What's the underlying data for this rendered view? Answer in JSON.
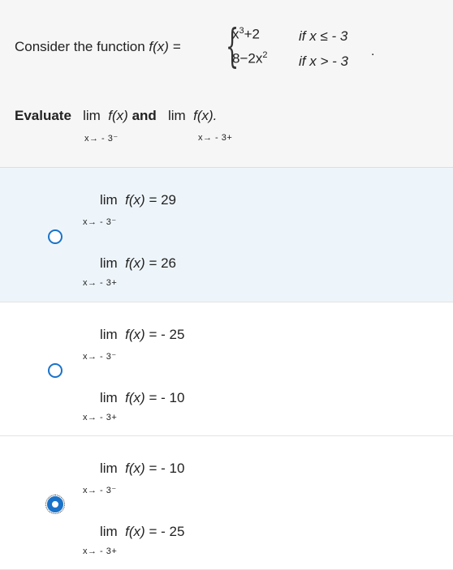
{
  "question": {
    "intro": "Consider the function",
    "fx": "f(x) =",
    "piece1_expr": "x",
    "piece1_exp": "3",
    "piece1_rest": "+2",
    "piece1_cond": "if x ≤ - 3",
    "piece2_expr": "8−2x",
    "piece2_exp": "2",
    "piece2_cond": "if x > - 3",
    "period": ".",
    "evaluate_word": "Evaluate",
    "lim1": "lim",
    "lim1_fx": "f(x)",
    "lim1_sub": "x→ - 3⁻",
    "and_word": "and",
    "lim2": "lim",
    "lim2_fx": "f(x).",
    "lim2_sub": "x→ - 3+"
  },
  "options": [
    {
      "selected": false,
      "line1": {
        "lim": "lim",
        "fx": "f(x)",
        "value": "= 29",
        "sub": "x→ - 3⁻"
      },
      "line2": {
        "lim": "lim",
        "fx": "f(x)",
        "value": "= 26",
        "sub": "x→ - 3+"
      }
    },
    {
      "selected": false,
      "line1": {
        "lim": "lim",
        "fx": "f(x)",
        "value": "= - 25",
        "sub": "x→ - 3⁻"
      },
      "line2": {
        "lim": "lim",
        "fx": "f(x)",
        "value": "= - 10",
        "sub": "x→ - 3+"
      }
    },
    {
      "selected": true,
      "line1": {
        "lim": "lim",
        "fx": "f(x)",
        "value": "= - 10",
        "sub": "x→ - 3⁻"
      },
      "line2": {
        "lim": "lim",
        "fx": "f(x)",
        "value": "= - 25",
        "sub": "x→ - 3+"
      }
    }
  ],
  "colors": {
    "accent": "#1a73c9",
    "question_bg": "#f6f6f6",
    "highlight_bg": "#eef5fa"
  }
}
